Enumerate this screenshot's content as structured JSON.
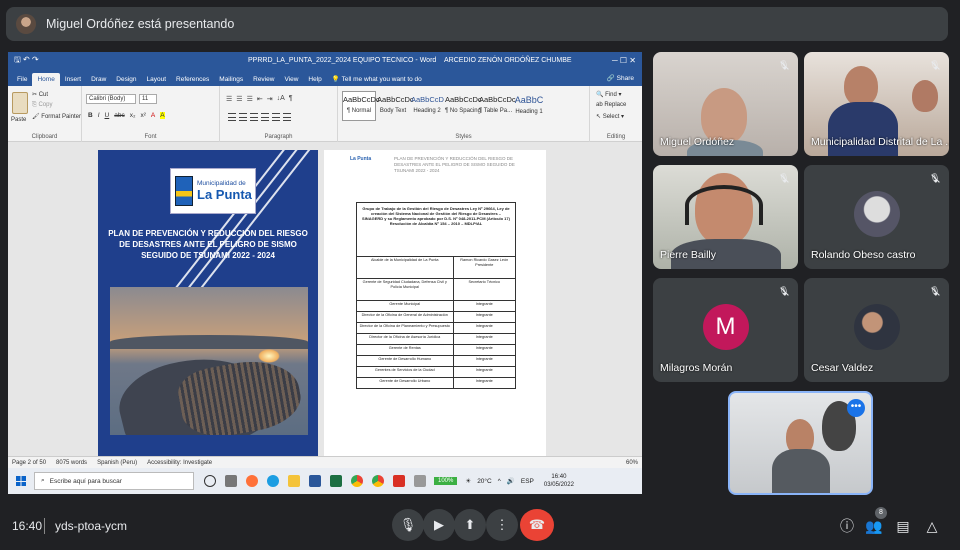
{
  "meet": {
    "presenter_banner": "Miguel Ordóñez está presentando",
    "time": "16:40",
    "separator": "|",
    "meeting_code": "yds-ptoa-ycm",
    "participant_count": "8",
    "accent_color": "#1a73e8",
    "end_call_color": "#ea4335"
  },
  "participants": [
    {
      "name": "Miguel Ordóñez",
      "muted": true
    },
    {
      "name": "Municipalidad Distrital de La ...",
      "muted": true
    },
    {
      "name": "Pierre Bailly",
      "muted": true
    },
    {
      "name": "Rolando Obeso castro",
      "muted": true
    },
    {
      "name": "Milagros Morán",
      "initial": "M",
      "muted": true
    },
    {
      "name": "Cesar Valdez",
      "muted": true
    },
    {
      "name": "",
      "self": true
    }
  ],
  "word": {
    "qat": "🖫 ↶ ↷",
    "title": "PPRRD_LA_PUNTA_2022_2024 EQUIPO TECNICO  -  Word",
    "user": "ARCEDIO ZENÓN ORDÓÑEZ CHUMBE",
    "window_controls": "─  ☐  ✕",
    "tabs": [
      "File",
      "Home",
      "Insert",
      "Draw",
      "Design",
      "Layout",
      "References",
      "Mailings",
      "Review",
      "View",
      "Help",
      "💡 Tell me what you want to do"
    ],
    "share": "🔗 Share",
    "clipboard": {
      "paste": "Paste",
      "cut": "✂ Cut",
      "copy": "⎘ Copy",
      "format_painter": "🖌 Format Painter",
      "label": "Clipboard"
    },
    "font": {
      "name": "Calibri (Body)",
      "size": "11",
      "label": "Font",
      "buttons": [
        "B",
        "I",
        "U",
        "abc",
        "x₂",
        "x²",
        "A",
        "A"
      ]
    },
    "paragraph": {
      "label": "Paragraph",
      "buttons": [
        "☰",
        "☰",
        "☰",
        "⇤",
        "⇥",
        "↓A",
        "¶"
      ]
    },
    "styles": {
      "label": "Styles",
      "items": [
        {
          "preview": "AaBbCcDc",
          "name": "¶ Normal"
        },
        {
          "preview": "AaBbCcDc",
          "name": "Body Text"
        },
        {
          "preview": "AaBbCcD",
          "name": "Heading 2"
        },
        {
          "preview": "AaBbCcDc",
          "name": "¶ No Spacing"
        },
        {
          "preview": "AaBbCcDc",
          "name": "¶ Table Pa..."
        },
        {
          "preview": "AaBbC",
          "name": "Heading 1"
        }
      ]
    },
    "editing": {
      "find": "🔍 Find ▾",
      "replace": "ab Replace",
      "select": "↖ Select ▾",
      "label": "Editing"
    },
    "cover": {
      "logo_line1": "Municipalidad de",
      "logo_line2": "La Punta",
      "title": "PLAN DE PREVENCIÓN Y REDUCCIÓN DEL RIESGO DE DESASTRES ANTE EL PELIGRO DE SISMO SEGUIDO DE TSUNAMI 2022 - 2024"
    },
    "page2": {
      "logo": "La Punta",
      "header": "PLAN DE PREVENCIÓN Y REDUCCIÓN DEL RIESGO DE DESASTRES ANTE EL PELIGRO DE SISMO SEGUIDO DE TSUNAMI 2022 - 2024",
      "table_heading": "Grupo de Trabajo de la Gestión del Riesgo de Desastres Ley Nº 29664, Ley de creación del Sistema Nacional de Gestión del Riesgo de Desastres – SINAGERD y su Reglamento aprobado por D.S. Nº 048-2011-PCM (Artículo 17) Resolución de Alcaldía Nº 154 – 2010 – MDLP/AL",
      "rows": [
        [
          "Alcalde de la Municipalidad de La Punta",
          "Ramon Ricardo Gasez León Presidente"
        ],
        [
          "Gerente de Seguridad Ciudadana, Defensa Civil y Policía Municipal",
          "Secretario Técnico"
        ],
        [
          "Gerente Municipal",
          "Integrante"
        ],
        [
          "Director de la Oficina de General de Administración",
          "Integrante"
        ],
        [
          "Director de la Oficina de Planeamiento y Presupuesto",
          "Integrante"
        ],
        [
          "Director de la Oficina de Asesoría Jurídica",
          "Integrante"
        ],
        [
          "Gerente de Rentas",
          "Integrante"
        ],
        [
          "Gerente de Desarrollo Humano",
          "Integrante"
        ],
        [
          "Gerentes de Servicios de la Ciudad",
          "Integrante"
        ],
        [
          "Gerente de Desarrollo Urbano",
          "Integrante"
        ]
      ]
    },
    "status": {
      "page": "Page 2 of 50",
      "words": "8075 words",
      "language": "Spanish (Peru)",
      "accessibility": "Accessibility: Investigate",
      "zoom": "60%"
    }
  },
  "taskbar": {
    "search_placeholder": "Escribe aquí para buscar",
    "battery": "100%",
    "weather": "20°C",
    "lang": "ESP",
    "clock_time": "16:40",
    "clock_date": "03/05/2022"
  }
}
